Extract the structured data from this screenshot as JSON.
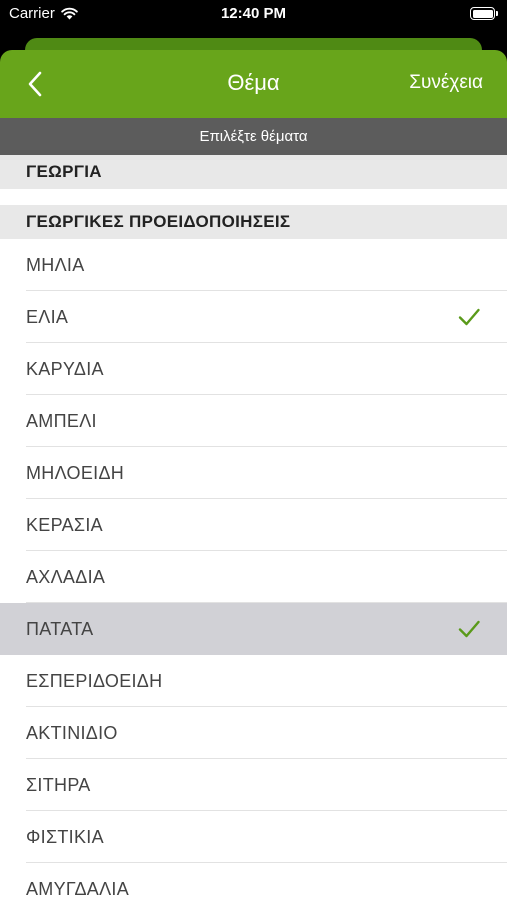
{
  "status_bar": {
    "carrier": "Carrier",
    "time": "12:40 PM"
  },
  "nav": {
    "title": "Θέμα",
    "continue_label": "Συνέχεια"
  },
  "subtitle": "Επιλέξτε θέματα",
  "sections": [
    {
      "header": "ΓΕΩΡΓΙΑ",
      "items": []
    },
    {
      "header": "ΓΕΩΡΓΙΚΕΣ ΠΡΟΕΙΔΟΠΟΙΗΣΕΙΣ",
      "items": [
        {
          "label": "ΜΗΛΙΑ",
          "checked": false,
          "highlighted": false
        },
        {
          "label": "ΕΛΙΑ",
          "checked": true,
          "highlighted": false
        },
        {
          "label": "ΚΑΡΥΔΙΑ",
          "checked": false,
          "highlighted": false
        },
        {
          "label": "ΑΜΠΕΛΙ",
          "checked": false,
          "highlighted": false
        },
        {
          "label": "ΜΗΛΟΕΙΔΗ",
          "checked": false,
          "highlighted": false
        },
        {
          "label": "ΚΕΡΑΣΙΑ",
          "checked": false,
          "highlighted": false
        },
        {
          "label": "ΑΧΛΑΔΙΑ",
          "checked": false,
          "highlighted": false
        },
        {
          "label": "ΠΑΤΑΤΑ",
          "checked": true,
          "highlighted": true
        },
        {
          "label": "ΕΣΠΕΡΙΔΟΕΙΔΗ",
          "checked": false,
          "highlighted": false
        },
        {
          "label": "ΑΚΤΙΝΙΔΙΟ",
          "checked": false,
          "highlighted": false
        },
        {
          "label": "ΣΙΤΗΡΑ",
          "checked": false,
          "highlighted": false
        },
        {
          "label": "ΦΙΣΤΙΚΙΑ",
          "checked": false,
          "highlighted": false
        },
        {
          "label": "ΑΜΥΓΔΑΛΙΑ",
          "checked": false,
          "highlighted": false
        }
      ]
    }
  ],
  "colors": {
    "accent": "#68a51b",
    "checkmark": "#5a9a1a",
    "subtitle_bg": "#5c5c5c",
    "section_bg": "#e8e8e8"
  },
  "icons": {
    "back": "chevron-left-icon",
    "check": "checkmark-icon",
    "wifi": "wifi-icon",
    "battery": "battery-icon"
  }
}
